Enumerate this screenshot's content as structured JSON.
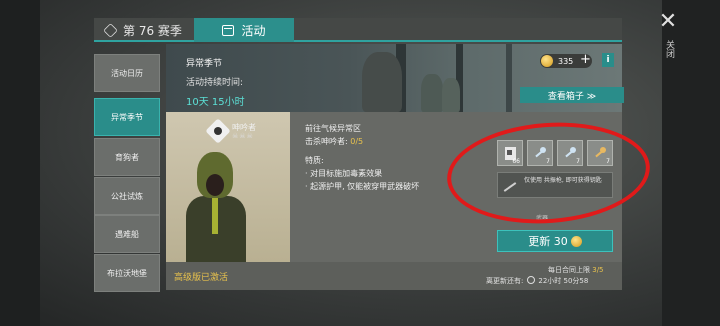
{
  "close": {
    "label": "关闭"
  },
  "tabs": {
    "season": "第 76 赛季",
    "activity": "活动"
  },
  "sidebar": {
    "items": [
      {
        "label": "活动日历"
      },
      {
        "label": "异常季节"
      },
      {
        "label": "育狗者"
      },
      {
        "label": "公社试炼"
      },
      {
        "label": "遇难船"
      },
      {
        "label": "布拉沃地堡"
      }
    ]
  },
  "banner": {
    "title": "异常季节",
    "duration_label": "活动持续时间:",
    "duration": "10天 15小时",
    "coins": "335",
    "plus": "+",
    "info": "i",
    "view_box": "查看箱子 ≫"
  },
  "enemy": {
    "name": "呻吟者",
    "skulls": "☠☠☠"
  },
  "mission": {
    "goal": "前往气候异常区",
    "kill_label": "击杀呻吟者: ",
    "kill_count": "0/5",
    "features_label": "特质:",
    "feature_1": "· 对目标施加毒素效果",
    "feature_2": "· 起源护甲, 仅能被穿甲武器破坏"
  },
  "rewards": [
    {
      "count": "66",
      "icon": "document-icon"
    },
    {
      "count": "7",
      "icon": "key-icon"
    },
    {
      "count": "7",
      "icon": "key-icon"
    },
    {
      "count": "7",
      "icon": "key-icon"
    }
  ],
  "reward_desc": "仅使用 共振枪, 即可获得钥匙",
  "weapon_label": "武器",
  "refresh": {
    "label": "更新 30"
  },
  "footer": {
    "activated": "高级版已激活",
    "limit_label": "每日合同上限",
    "limit_value": "3/5",
    "update_label": "离更新还有:",
    "update_time": "22小时 50分58"
  },
  "colors": {
    "accent": "#2a8d8a",
    "gold": "#e8c24d",
    "annotation": "#e01a1a"
  }
}
